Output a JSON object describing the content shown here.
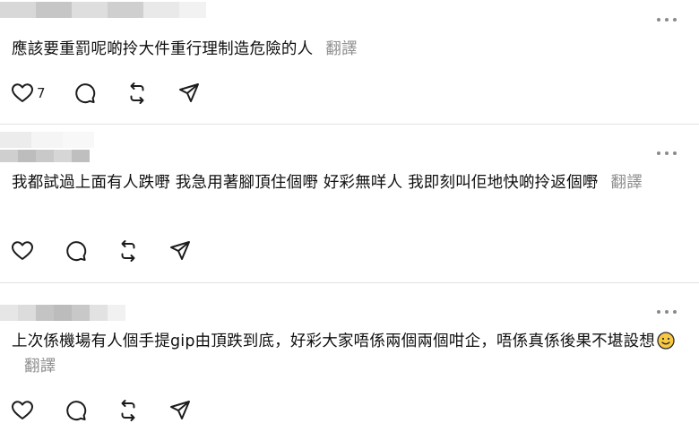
{
  "comments": [
    {
      "text": "應該要重罰呢啲拎大件重行理制造危險的人",
      "translate_label": "翻譯",
      "like_count": "7"
    },
    {
      "text": "我都試過上面有人跌嘢 我急用著腳頂住個嘢 好彩無咩人 我即刻叫佢地快啲拎返個嘢",
      "translate_label": "翻譯",
      "like_count": ""
    },
    {
      "text": "上次係機場有人個手提gip由頂跌到底，好彩大家唔係兩個兩個咁企，唔係真係後果不堪設想",
      "translate_label": "翻譯",
      "like_count": ""
    }
  ],
  "icons": {
    "like": "heart-icon",
    "reply": "comment-bubble-icon",
    "repost": "repost-icon",
    "share": "send-icon",
    "more": "more-horizontal-icon",
    "emoji": "slightly-smiling-face-emoji"
  },
  "colors": {
    "text": "#101010",
    "muted": "#8e8e8e",
    "divider": "#e3e3e3",
    "icon": "#1c1c1c"
  }
}
